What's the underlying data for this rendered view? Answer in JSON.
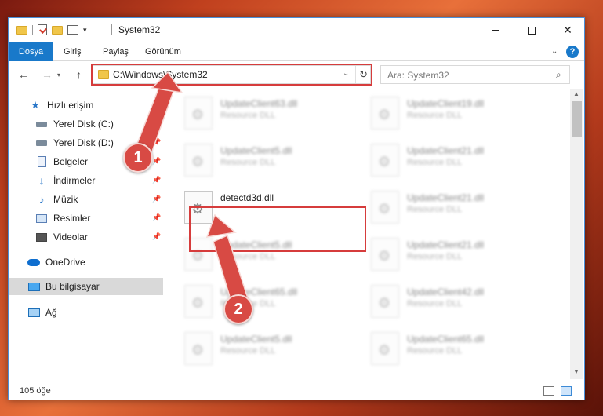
{
  "window": {
    "title": "System32",
    "controls": {
      "minimize": "minimize",
      "maximize": "maximize",
      "close": "close"
    }
  },
  "ribbon": {
    "tabs": [
      "Dosya",
      "Giriş",
      "Paylaş",
      "Görünüm"
    ],
    "help_label": "?"
  },
  "address_bar": {
    "path": "C:\\Windows\\System32",
    "search_placeholder": "Ara: System32"
  },
  "sidebar": {
    "items": [
      {
        "label": "Hızlı erişim",
        "icon": "star-icon",
        "pinned": false
      },
      {
        "label": "Yerel Disk (C:)",
        "icon": "drive-icon",
        "pinned": true
      },
      {
        "label": "Yerel Disk (D:)",
        "icon": "drive-icon",
        "pinned": true
      },
      {
        "label": "Belgeler",
        "icon": "document-icon",
        "pinned": true
      },
      {
        "label": "İndirmeler",
        "icon": "download-icon",
        "pinned": true
      },
      {
        "label": "Müzik",
        "icon": "music-icon",
        "pinned": true
      },
      {
        "label": "Resimler",
        "icon": "pictures-icon",
        "pinned": true
      },
      {
        "label": "Videolar",
        "icon": "video-icon",
        "pinned": true
      },
      {
        "label": "OneDrive",
        "icon": "cloud-icon",
        "pinned": false
      },
      {
        "label": "Bu bilgisayar",
        "icon": "computer-icon",
        "pinned": false,
        "selected": true
      },
      {
        "label": "Ağ",
        "icon": "network-icon",
        "pinned": false
      }
    ]
  },
  "files": {
    "left_column": [
      {
        "name": "UpdateClient63.dll",
        "type": "Resource DLL",
        "blurred": true
      },
      {
        "name": "UpdateClient5.dll",
        "type": "Resource DLL",
        "blurred": true
      },
      {
        "name": "detectd3d.dll",
        "type": "",
        "blurred": false
      },
      {
        "name": "UpdateClient5.dll",
        "type": "Resource DLL",
        "blurred": true
      },
      {
        "name": "UpdateClient65.dll",
        "type": "Resource DLL",
        "blurred": true
      },
      {
        "name": "UpdateClient5.dll",
        "type": "Resource DLL",
        "blurred": true
      }
    ],
    "right_column": [
      {
        "name": "UpdateClient19.dll",
        "type": "Resource DLL",
        "blurred": true
      },
      {
        "name": "UpdateClient21.dll",
        "type": "Resource DLL",
        "blurred": true
      },
      {
        "name": "UpdateClient21.dll",
        "type": "Resource DLL",
        "blurred": true
      },
      {
        "name": "UpdateClient21.dll",
        "type": "Resource DLL",
        "blurred": true
      },
      {
        "name": "UpdateClient42.dll",
        "type": "Resource DLL",
        "blurred": true
      },
      {
        "name": "UpdateClient65.dll",
        "type": "Resource DLL",
        "blurred": true
      }
    ]
  },
  "status_bar": {
    "item_count": "105 öğe"
  },
  "annotations": {
    "marker_1": "1",
    "marker_2": "2",
    "color": "#d84a44"
  }
}
